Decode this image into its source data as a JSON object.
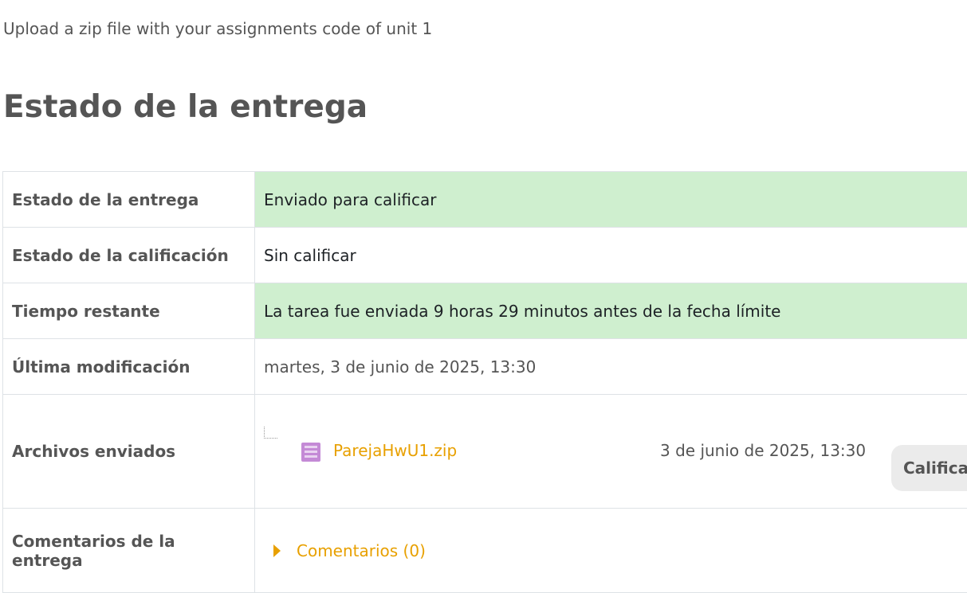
{
  "intro_text": "Upload a zip file with your assignments code of unit 1",
  "section_title": "Estado de la entrega",
  "rows": {
    "submission_status": {
      "label": "Estado de la entrega",
      "value": "Enviado para calificar"
    },
    "grading_status": {
      "label": "Estado de la calificación",
      "value": "Sin calificar"
    },
    "time_remaining": {
      "label": "Tiempo restante",
      "value": "La tarea fue enviada 9 horas 29 minutos antes de la fecha límite"
    },
    "last_modified": {
      "label": "Última modificación",
      "value": "martes, 3 de junio de 2025, 13:30"
    },
    "submitted_files": {
      "label": "Archivos enviados",
      "file_name": "ParejaHwU1.zip",
      "file_date": "3 de junio de 2025, 13:30",
      "file_icon": "zip-archive-icon",
      "action_label": "Califica"
    },
    "submission_comments": {
      "label": "Comentarios de la entrega",
      "link": "Comentarios (0)"
    }
  },
  "colors": {
    "success_bg": "#cfefcf",
    "link": "#e8a000",
    "text": "#555555"
  }
}
